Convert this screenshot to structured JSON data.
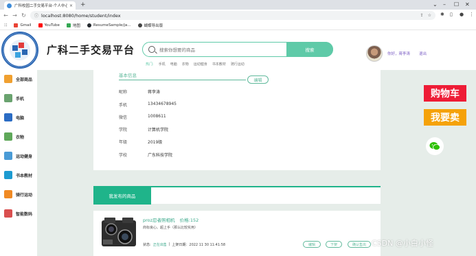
{
  "browser": {
    "tab_title": "广科校园二手交易平台-个人中心",
    "tab_close": "×",
    "new_tab": "+",
    "url": "localhost:8080/home/student/index",
    "bookmarks": [
      {
        "label": "Gmail",
        "color": "#ea4335"
      },
      {
        "label": "YouTube",
        "color": "#ff0000"
      },
      {
        "label": "地图",
        "color": "#34a853"
      },
      {
        "label": "ResumeSample/ja...",
        "color": "#24292e"
      },
      {
        "label": "蝴蝶导出版",
        "color": "#444444"
      }
    ]
  },
  "header": {
    "site_name": "广科二手交易平台",
    "search_placeholder": "搜索你想要的商品",
    "search_button": "搜索",
    "hot_label": "热门:",
    "hot_words": [
      "手机",
      "电脑",
      "衣物",
      "运动健身",
      "书本教材",
      "骑行运动"
    ],
    "greeting": "你好，蒋李涛",
    "logout": "退出"
  },
  "sidebar": {
    "items": [
      {
        "label": "全部商品",
        "color": "#f0a030"
      },
      {
        "label": "手机",
        "color": "#6aa36f"
      },
      {
        "label": "电脑",
        "color": "#2b6cc4"
      },
      {
        "label": "衣物",
        "color": "#5fa85a"
      },
      {
        "label": "运动健身",
        "color": "#4a9bd6"
      },
      {
        "label": "书本教材",
        "color": "#1d9bd1"
      },
      {
        "label": "骑行运动",
        "color": "#f08a24"
      },
      {
        "label": "智能数码",
        "color": "#d94f4f"
      }
    ]
  },
  "profile": {
    "section_title": "基本信息",
    "edit_button": "编辑",
    "fields": [
      {
        "key": "昵称",
        "value": "蒋李涛"
      },
      {
        "key": "手机",
        "value": "13434678945"
      },
      {
        "key": "微信",
        "value": "1008611"
      },
      {
        "key": "学院",
        "value": "计算机学院"
      },
      {
        "key": "年级",
        "value": "2019级"
      },
      {
        "key": "学校",
        "value": "广东科技学院"
      }
    ]
  },
  "posted": {
    "tab_label": "我发布的商品",
    "item": {
      "title": "proz忍者照相机",
      "price": "价格:152",
      "desc": "商标良心。超上手（那么比较实用）",
      "status_label": "状态:",
      "status_value": "正在出售",
      "sep": "|",
      "date": "上架日期：2022 11 30 11:41:58",
      "buttons": [
        "编辑",
        "下架",
        "确认售出"
      ]
    }
  },
  "floating": {
    "cart": "购物车",
    "sell": "我要卖"
  },
  "watermark": "CSDN @小白小怪"
}
